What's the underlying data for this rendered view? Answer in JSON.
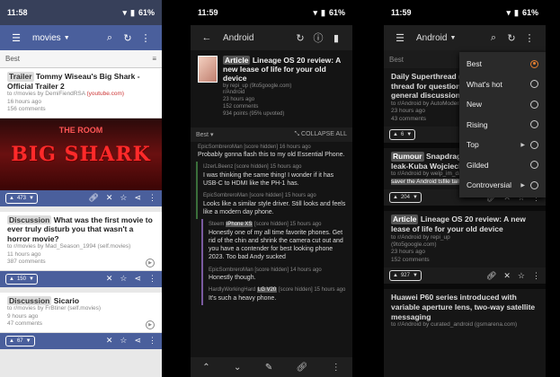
{
  "phone1": {
    "time": "11:58",
    "battery": "61%",
    "subreddit": "movies",
    "sort": "Best",
    "posts": [
      {
        "tag": "Trailer",
        "title": "Tommy Wiseau's Big Shark - Official Trailer 2",
        "meta1": "to r/movies by DemiFiendRSA",
        "link": "(youtube.com)",
        "age": "16 hours ago",
        "comments": "156 comments",
        "score": "473",
        "thumb_small": "THE ROOM",
        "thumb_big": "BIG SHARK"
      },
      {
        "tag": "Discussion",
        "title": "What was the first movie to ever truly disturb you that wasn't a horror movie?",
        "meta1": "to r/movies by Mad_Season_1994",
        "link": "(self.movies)",
        "age": "11 hours ago",
        "comments": "387 comments",
        "score": "150"
      },
      {
        "tag": "Discussion",
        "title": "Sicario",
        "meta1": "to r/movies by FrBtiner",
        "link": "(self.movies)",
        "age": "9 hours ago",
        "comments": "47 comments",
        "score": "67"
      }
    ]
  },
  "phone2": {
    "time": "11:59",
    "battery": "61%",
    "subreddit": "Android",
    "post": {
      "tag": "Article",
      "title": "Lineage OS 20 review: A new lease of life for your old device",
      "by": "by repi_up",
      "link": "(9to5google.com)",
      "sub": "r/Android",
      "age": "23 hours ago",
      "comments": "152 comments",
      "score": "934 points (95% upvoted)"
    },
    "sort": "Best",
    "collapse": "COLLAPSE ALL",
    "comments": [
      {
        "author": "EpicSombreroMan",
        "score": "[score hidden]",
        "age": "16 hours ago",
        "text": "Probably gonna flash this to my old Essential Phone.",
        "lvl": "lvl0"
      },
      {
        "author": "IJzerLBeenz",
        "score": "[score hidden]",
        "age": "15 hours ago",
        "text": "I was thinking the same thing! I wonder if it has USB-C to HDMI like the PH-1 has.",
        "lvl": "lvl1"
      },
      {
        "author": "EpicSombreroMan",
        "score": "[score hidden]",
        "age": "15 hours ago",
        "text": "Looks like a similar style driver. Still looks and feels like a modern day phone.",
        "lvl": "lvl2"
      },
      {
        "author": "Steem",
        "hl": "iPhone XS",
        "score": "[score hidden]",
        "age": "15 hours ago",
        "text": "Honestly one of my all time favorite phones. Get rid of the chin and shrink the camera cut out and you have a contender for best looking phone 2023. Too bad Andy sucked",
        "lvl": "lvl3"
      },
      {
        "author": "EpicSombreroMan",
        "score": "[score hidden]",
        "age": "14 hours ago",
        "text": "Honestly though.",
        "lvl": "lvl4"
      },
      {
        "author": "HardlyWorkingHard",
        "hl": "LG V20",
        "score": "[score hidden]",
        "age": "15 hours ago",
        "text": "It's such a heavy phone.",
        "lvl": "lvl4"
      }
    ]
  },
  "phone3": {
    "time": "11:59",
    "battery": "61%",
    "subreddit": "Android",
    "sort": "Best",
    "posts": [
      {
        "title": "Daily Superthread (Mar 23...",
        "title2": "thread for questions, devi...",
        "title3": "general discussions)",
        "meta": "to r/Android by AutoModerat...",
        "age": "23 hours ago",
        "comments": "43 comments",
        "score": "6"
      },
      {
        "tag": "Rumour",
        "title": "Snapdragon 8 g...",
        "title2": "leak-Kuba Wojciechowski...",
        "meta": "to r/Android by welp_im_damned",
        "meta2": "saver the Android tsfile tails...",
        "age": "",
        "comments": "",
        "score": "204"
      },
      {
        "tag": "Article",
        "title": "Lineage OS 20 review: A new lease of life for your old device",
        "meta": "to r/Android by repi_up",
        "meta2": "(9to5google.com)",
        "age": "23 hours ago",
        "comments": "152 comments",
        "score": "927"
      },
      {
        "title": "Huawei P60 series introduced with variable aperture lens, two-way satellite messaging",
        "meta": "to r/Android by curated_android",
        "meta2": "(gsmarena.com)",
        "score": ""
      }
    ],
    "menu": [
      {
        "label": "Best",
        "selected": true,
        "sub": false
      },
      {
        "label": "What's hot",
        "selected": false,
        "sub": false
      },
      {
        "label": "New",
        "selected": false,
        "sub": false
      },
      {
        "label": "Rising",
        "selected": false,
        "sub": false
      },
      {
        "label": "Top",
        "selected": false,
        "sub": true
      },
      {
        "label": "Gilded",
        "selected": false,
        "sub": false
      },
      {
        "label": "Controversial",
        "selected": false,
        "sub": true
      }
    ]
  }
}
